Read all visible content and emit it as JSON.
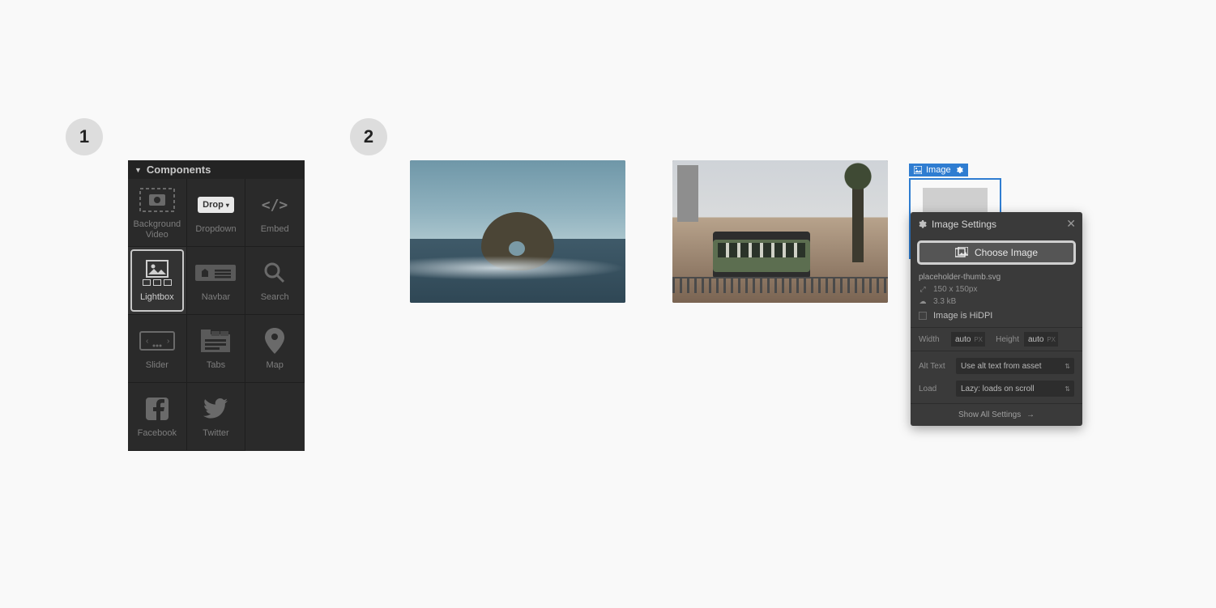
{
  "steps": {
    "one": "1",
    "two": "2"
  },
  "componentsPanel": {
    "title": "Components",
    "items": [
      {
        "label": "Background Video"
      },
      {
        "label": "Dropdown",
        "pill": "Drop"
      },
      {
        "label": "Embed"
      },
      {
        "label": "Lightbox"
      },
      {
        "label": "Navbar"
      },
      {
        "label": "Search"
      },
      {
        "label": "Slider"
      },
      {
        "label": "Tabs"
      },
      {
        "label": "Map"
      },
      {
        "label": "Facebook"
      },
      {
        "label": "Twitter"
      }
    ]
  },
  "selectedElement": {
    "tagLabel": "Image"
  },
  "imageSettings": {
    "title": "Image Settings",
    "chooseButton": "Choose Image",
    "filename": "placeholder-thumb.svg",
    "dimensions": "150 x 150px",
    "filesize": "3.3 kB",
    "hidpiLabel": "Image is HiDPI",
    "widthLabel": "Width",
    "widthValue": "auto",
    "widthUnit": "PX",
    "heightLabel": "Height",
    "heightValue": "auto",
    "heightUnit": "PX",
    "altLabel": "Alt Text",
    "altValue": "Use alt text from asset",
    "loadLabel": "Load",
    "loadValue": "Lazy: loads on scroll",
    "showAll": "Show All Settings"
  }
}
